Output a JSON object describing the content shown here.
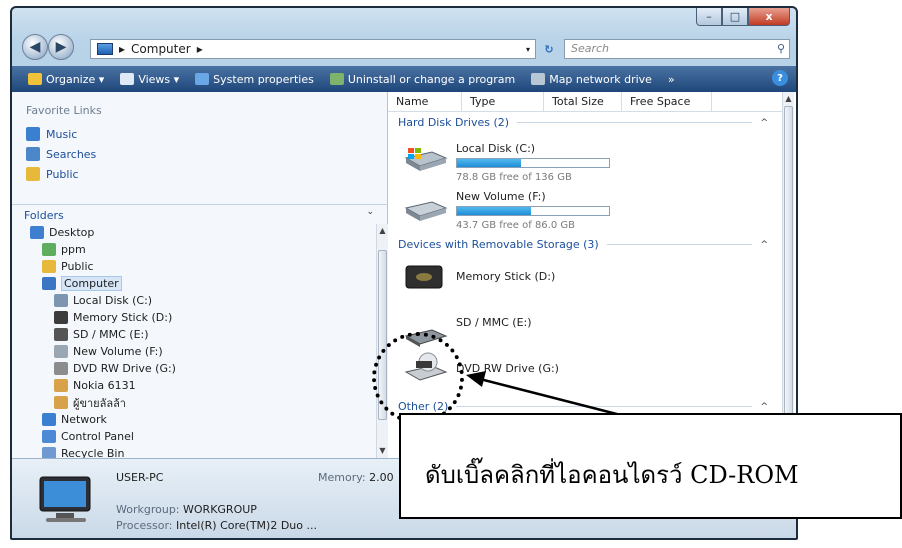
{
  "window": {
    "controls": {
      "minimize": "–",
      "maximize": "□",
      "close": "x"
    }
  },
  "address": {
    "back_icon": "back-arrow-icon",
    "forward_icon": "forward-arrow-icon",
    "location_sep": "▸",
    "location": "Computer",
    "trailing_sep": "▸",
    "dropdown": "▾",
    "refresh": "↻",
    "search_placeholder": "Search",
    "search_icon": "⚲"
  },
  "toolbar": {
    "organize": "Organize ▾",
    "views": "Views ▾",
    "system_properties": "System properties",
    "uninstall": "Uninstall or change a program",
    "map_drive": "Map network drive",
    "more": "»",
    "help": "?"
  },
  "favorites": {
    "header": "Favorite Links",
    "items": [
      {
        "label": "Music",
        "color": "#3a7fd0"
      },
      {
        "label": "Searches",
        "color": "#4b86c9"
      },
      {
        "label": "Public",
        "color": "#e6b93a"
      }
    ]
  },
  "folders": {
    "header": "Folders",
    "chevron": "⌄",
    "tree": [
      {
        "label": "Desktop",
        "indent": 0,
        "color": "#3e7fcf",
        "icon": "desktop-icon"
      },
      {
        "label": "ppm",
        "indent": 1,
        "color": "#5fae5f",
        "icon": "user-folder-icon"
      },
      {
        "label": "Public",
        "indent": 1,
        "color": "#e6b93a",
        "icon": "folder-icon"
      },
      {
        "label": "Computer",
        "indent": 1,
        "color": "#3b76c4",
        "icon": "computer-icon",
        "selected": true
      },
      {
        "label": "Local Disk (C:)",
        "indent": 2,
        "color": "#7c95b0",
        "icon": "hard-disk-icon"
      },
      {
        "label": "Memory Stick (D:)",
        "indent": 2,
        "color": "#3c3c3c",
        "icon": "memory-stick-icon"
      },
      {
        "label": "SD / MMC (E:)",
        "indent": 2,
        "color": "#555555",
        "icon": "sd-card-icon"
      },
      {
        "label": "New Volume (F:)",
        "indent": 2,
        "color": "#9aa7b3",
        "icon": "hard-disk-icon"
      },
      {
        "label": "DVD RW Drive (G:)",
        "indent": 2,
        "color": "#8c8c8c",
        "icon": "dvd-drive-icon"
      },
      {
        "label": "Nokia 6131",
        "indent": 2,
        "color": "#d8a24a",
        "icon": "phone-icon"
      },
      {
        "label": "ผู้ขายลัลล้า",
        "indent": 2,
        "color": "#d8a24a",
        "icon": "user-folder-icon"
      },
      {
        "label": "Network",
        "indent": 1,
        "color": "#3a7fd0",
        "icon": "network-icon"
      },
      {
        "label": "Control Panel",
        "indent": 1,
        "color": "#4c8ad6",
        "icon": "control-panel-icon"
      },
      {
        "label": "Recycle Bin",
        "indent": 1,
        "color": "#6d9ad0",
        "icon": "recycle-bin-icon"
      }
    ]
  },
  "columns": [
    "Name",
    "Type",
    "Total Size",
    "Free Space"
  ],
  "groups": {
    "hdd": "Hard Disk Drives (2)",
    "removable": "Devices with Removable Storage (3)",
    "other": "Other (2)",
    "chevron": "^"
  },
  "drives": [
    {
      "name": "Local Disk (C:)",
      "free": "78.8 GB free of 136 GB",
      "used_fraction": 0.42
    },
    {
      "name": "New Volume (F:)",
      "free": "43.7 GB free of 86.0 GB",
      "used_fraction": 0.49
    },
    {
      "name": "Memory Stick (D:)"
    },
    {
      "name": "SD / MMC (E:)"
    },
    {
      "name": "DVD RW Drive (G:)"
    }
  ],
  "details": {
    "computer": "USER-PC",
    "memory_label": "Memory:",
    "memory_value": "2.00",
    "workgroup_label": "Workgroup:",
    "workgroup_value": "WORKGROUP",
    "processor_label": "Processor:",
    "processor_value": "Intel(R) Core(TM)2 Duo ..."
  },
  "annotation": {
    "text": "ดับเบิ๊ลคลิกที่ไอคอนไดรว์ CD-ROM"
  }
}
